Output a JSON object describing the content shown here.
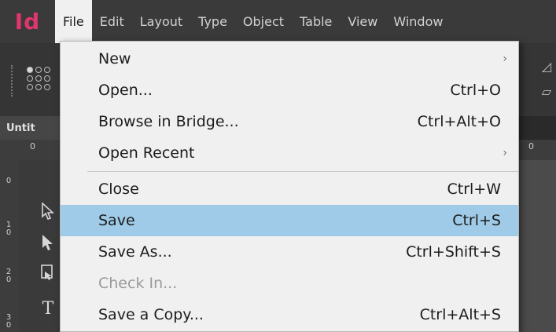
{
  "app": {
    "logo_text": "Id",
    "logo_color": "#e0356d"
  },
  "menubar": {
    "items": [
      {
        "label": "File"
      },
      {
        "label": "Edit"
      },
      {
        "label": "Layout"
      },
      {
        "label": "Type"
      },
      {
        "label": "Object"
      },
      {
        "label": "Table"
      },
      {
        "label": "View"
      },
      {
        "label": "Window"
      }
    ],
    "active": "File"
  },
  "document": {
    "tab_label": "Untit"
  },
  "rulers": {
    "horizontal": [
      "0",
      "0"
    ],
    "vertical": [
      "0",
      "1\n0",
      "2\n0",
      "3\n0"
    ]
  },
  "tools": {
    "icons": [
      "selection-arrow-icon",
      "direct-selection-icon",
      "page-tool-icon",
      "type-tool-icon"
    ]
  },
  "file_menu": {
    "items": [
      {
        "label": "New",
        "shortcut": "",
        "submenu": true,
        "state": "normal"
      },
      {
        "label": "Open...",
        "shortcut": "Ctrl+O",
        "submenu": false,
        "state": "normal"
      },
      {
        "label": "Browse in Bridge...",
        "shortcut": "Ctrl+Alt+O",
        "submenu": false,
        "state": "normal"
      },
      {
        "label": "Open Recent",
        "shortcut": "",
        "submenu": true,
        "state": "normal"
      },
      {
        "label": "Close",
        "shortcut": "Ctrl+W",
        "submenu": false,
        "state": "normal"
      },
      {
        "label": "Save",
        "shortcut": "Ctrl+S",
        "submenu": false,
        "state": "highlighted"
      },
      {
        "label": "Save As...",
        "shortcut": "Ctrl+Shift+S",
        "submenu": false,
        "state": "normal"
      },
      {
        "label": "Check In...",
        "shortcut": "",
        "submenu": false,
        "state": "disabled"
      },
      {
        "label": "Save a Copy...",
        "shortcut": "Ctrl+Alt+S",
        "submenu": false,
        "state": "normal"
      }
    ],
    "submenu_glyph": "›",
    "highlight_color": "#9fcbe8"
  }
}
